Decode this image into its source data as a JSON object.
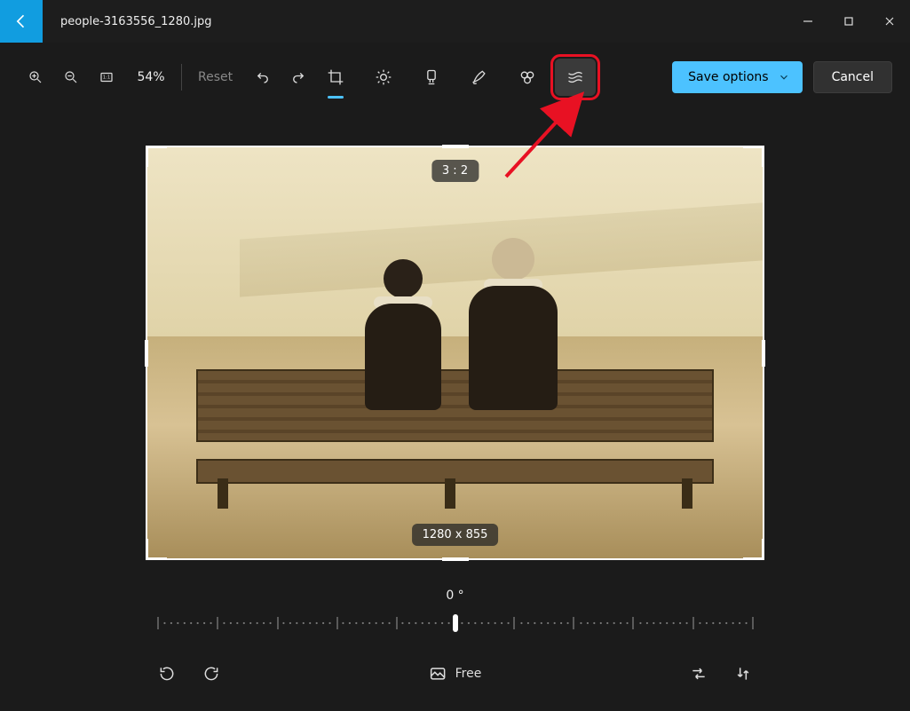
{
  "titlebar": {
    "filename": "people-3163556_1280.jpg"
  },
  "toolbar": {
    "zoom_percent": "54%",
    "reset_label": "Reset",
    "save_label": "Save options",
    "cancel_label": "Cancel"
  },
  "editor_modes": {
    "crop": "crop-icon",
    "adjust": "brightness-icon",
    "filter": "filter-icon",
    "markup": "markup-icon",
    "retouch": "retouch-icon",
    "background": "background-effects-icon",
    "active": "crop",
    "highlighted": "background"
  },
  "crop": {
    "aspect_ratio_badge": "3 : 2",
    "dimensions_badge": "1280 x 855"
  },
  "rotation": {
    "angle_label": "0 °",
    "angle_value": 0,
    "range_min": -45,
    "range_max": 45
  },
  "bottombar": {
    "aspect_mode_label": "Free"
  },
  "colors": {
    "accent": "#4cc2ff",
    "back_button": "#119de0",
    "annotation": "#e81123"
  }
}
